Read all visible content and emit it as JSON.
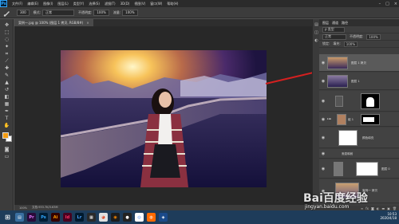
{
  "app": {
    "logo_text": "Ps"
  },
  "menu": [
    "文件(F)",
    "编辑(E)",
    "图像(I)",
    "图层(L)",
    "类型(Y)",
    "选择(S)",
    "滤镜(T)",
    "3D(D)",
    "视图(V)",
    "窗口(W)",
    "帮助(H)"
  ],
  "options": {
    "size_value": "300",
    "mode_label": "模式:",
    "mode_value": "正常",
    "opacity_label": "不透明度:",
    "opacity_value": "100%",
    "flow_label": "流量:",
    "flow_value": "100%"
  },
  "document": {
    "tab_title": "案例一.jpg @ 100% (图层 1 拷贝, RGB/8#)",
    "close": "×"
  },
  "status": {
    "zoom": "100%",
    "doc_size": "文档:933.7K/3.63M"
  },
  "layers_panel": {
    "tabs": [
      "图层",
      "通道",
      "路径"
    ],
    "filter_label": "ρ 类型",
    "blend_mode": "正常",
    "opacity_label": "不透明度:",
    "opacity_value": "100%",
    "lock_label": "锁定:",
    "fill_label": "填充:",
    "fill_value": "100%",
    "layers": [
      {
        "name": "图层 1 拷贝",
        "selected": true
      },
      {
        "name": "图层 1",
        "selected": false
      },
      {
        "name": "",
        "selected": false
      },
      {
        "name": "组 1",
        "selected": false
      },
      {
        "name": "颜色填充",
        "selected": false
      },
      {
        "name": "渐变映射",
        "selected": false
      },
      {
        "name": "图层 0",
        "selected": false
      },
      {
        "name": "案例一 拷贝",
        "selected": false
      }
    ]
  },
  "watermark": {
    "text": "Bai百度经验",
    "url": "jingyan.baidu.com"
  },
  "clock": {
    "time": "10:53",
    "date": "2020/4/18"
  },
  "colors": {
    "foreground": "#f39c12",
    "background": "#ffffff",
    "arrow": "#d42020"
  }
}
